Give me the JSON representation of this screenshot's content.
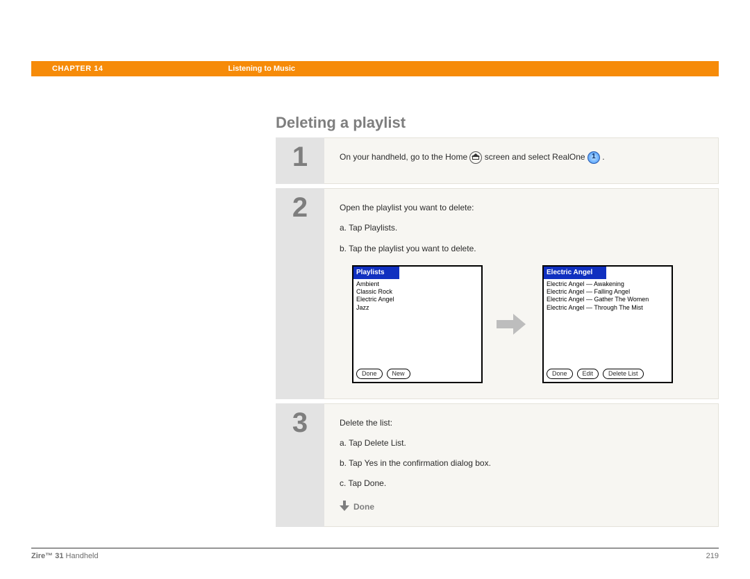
{
  "header": {
    "chapter_label": "CHAPTER 14",
    "chapter_title": "Listening to Music"
  },
  "section_title": "Deleting a playlist",
  "steps": {
    "n1": "1",
    "n2": "2",
    "n3": "3",
    "s1_before": "On your handheld, go to the Home ",
    "s1_mid": " screen and select RealOne ",
    "s1_after": " .",
    "realone_glyph": "1",
    "s2_intro": "Open the playlist you want to delete:",
    "s2a": "a.  Tap Playlists.",
    "s2b": "b.  Tap the playlist you want to delete.",
    "s3_intro": "Delete the list:",
    "s3a": "a.  Tap Delete List.",
    "s3b": "b.  Tap Yes in the confirmation dialog box.",
    "s3c": "c.  Tap Done.",
    "done_label": "Done"
  },
  "screens": {
    "left": {
      "title": "Playlists",
      "items": [
        "Ambient",
        "Classic Rock",
        "Electric Angel",
        "Jazz"
      ],
      "buttons": [
        "Done",
        "New"
      ]
    },
    "right": {
      "title": "Electric Angel",
      "items": [
        "Electric Angel — Awakening",
        "Electric Angel — Falling Angel",
        "Electric Angel — Gather The Women",
        "Electric Angel — Through The Mist"
      ],
      "buttons": [
        "Done",
        "Edit",
        "Delete List"
      ]
    }
  },
  "footer": {
    "product_bold": "Zire™ 31",
    "product_rest": " Handheld",
    "page": "219"
  }
}
